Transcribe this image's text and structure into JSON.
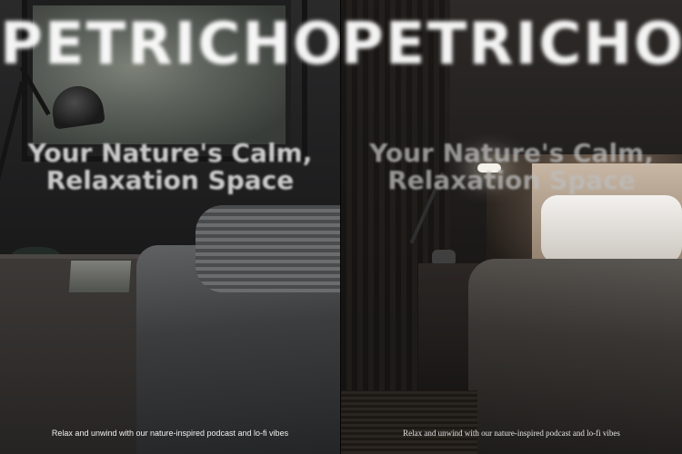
{
  "panels": [
    {
      "brand": "PETRICHOR",
      "tagline_line1": "Your Nature's Calm,",
      "tagline_line2": "Relaxation Space",
      "caption": "Relax and unwind with our nature-inspired podcast and lo-fi vibes"
    },
    {
      "brand": "PETRICHOR",
      "tagline_line1": "Your Nature's Calm,",
      "tagline_line2": "Relaxation Space",
      "caption": "Relax and unwind with our nature-inspired podcast and lo-fi vibes"
    }
  ],
  "colors": {
    "brand_text": "#ffffff",
    "tagline_text": "#e7e7e7",
    "caption_text": "#f2f2f2",
    "lamp_glow": "#f4f0ea"
  }
}
